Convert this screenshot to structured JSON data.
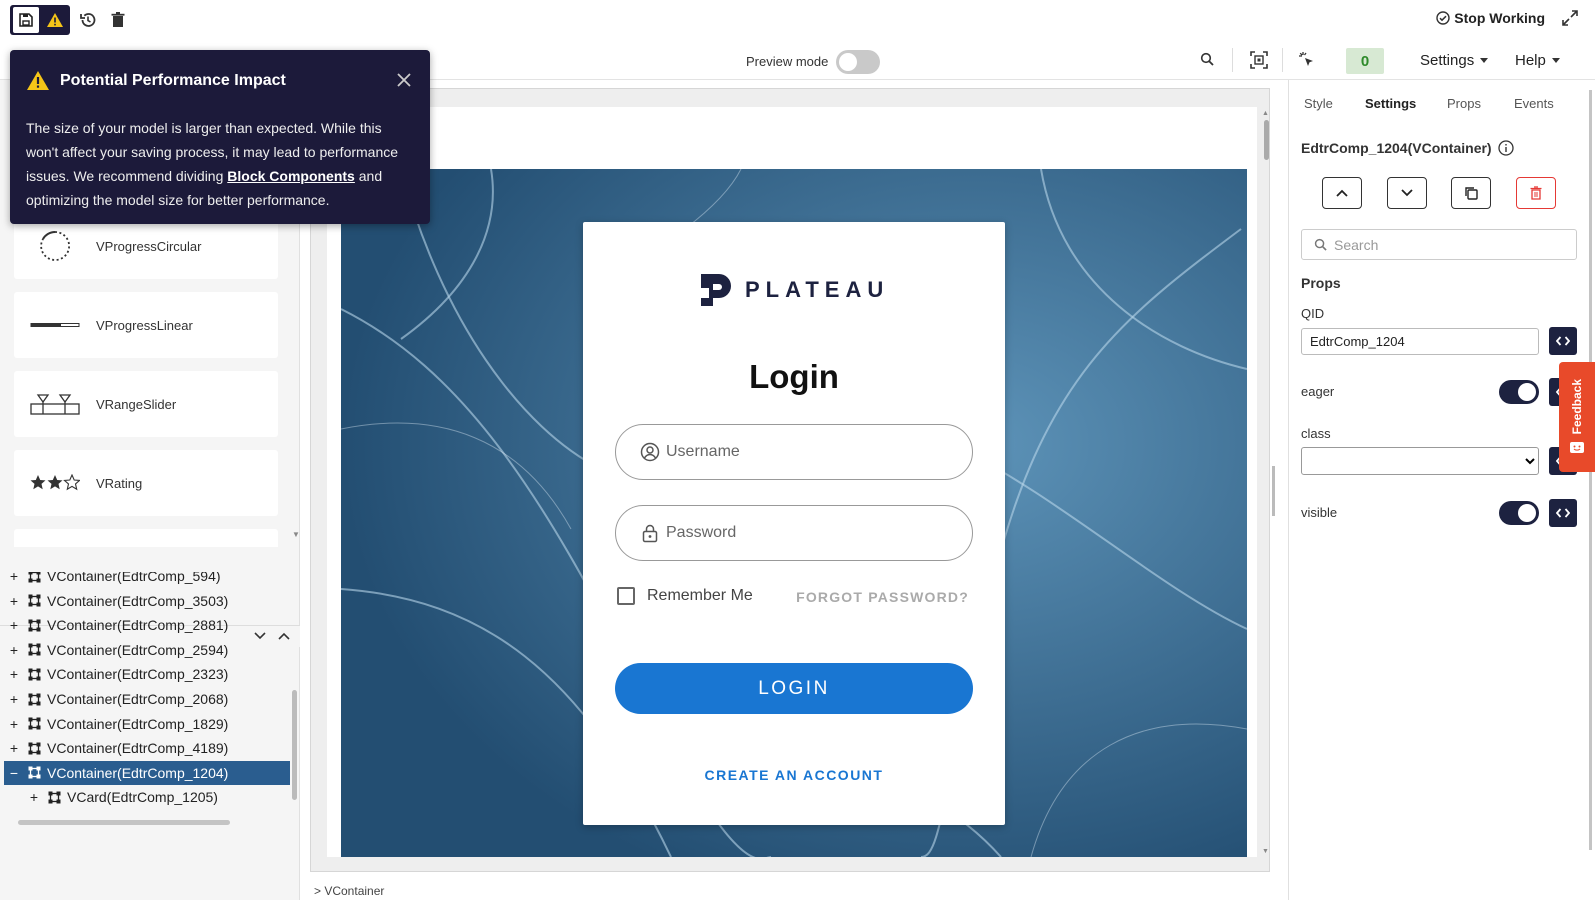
{
  "topbar": {
    "stop_working": "Stop Working"
  },
  "toolbar": {
    "preview_label": "Preview mode",
    "counter": "0",
    "settings_menu": "Settings",
    "help_menu": "Help"
  },
  "popup": {
    "title": "Potential Performance Impact",
    "body_before": "The size of your model is larger than expected. While this won't affect your saving process, it may lead to performance issues. We recommend dividing",
    "link": "Block Components",
    "body_after": "and optimizing the model size for better performance."
  },
  "components": [
    {
      "label": "VProgressCircular",
      "icon": "progress-circular-icon"
    },
    {
      "label": "VProgressLinear",
      "icon": "progress-linear-icon"
    },
    {
      "label": "VRangeSlider",
      "icon": "range-slider-icon"
    },
    {
      "label": "VRating",
      "icon": "rating-stars-icon"
    }
  ],
  "tree": [
    {
      "label": "VContainer(EdtrComp_594)",
      "expander": "+",
      "selected": false,
      "indent": 0
    },
    {
      "label": "VContainer(EdtrComp_3503)",
      "expander": "+",
      "selected": false,
      "indent": 0
    },
    {
      "label": "VContainer(EdtrComp_2881)",
      "expander": "+",
      "selected": false,
      "indent": 0
    },
    {
      "label": "VContainer(EdtrComp_2594)",
      "expander": "+",
      "selected": false,
      "indent": 0
    },
    {
      "label": "VContainer(EdtrComp_2323)",
      "expander": "+",
      "selected": false,
      "indent": 0
    },
    {
      "label": "VContainer(EdtrComp_2068)",
      "expander": "+",
      "selected": false,
      "indent": 0
    },
    {
      "label": "VContainer(EdtrComp_1829)",
      "expander": "+",
      "selected": false,
      "indent": 0
    },
    {
      "label": "VContainer(EdtrComp_4189)",
      "expander": "+",
      "selected": false,
      "indent": 0
    },
    {
      "label": "VContainer(EdtrComp_1204)",
      "expander": "−",
      "selected": true,
      "indent": 0
    },
    {
      "label": "VCard(EdtrComp_1205)",
      "expander": "+",
      "selected": false,
      "indent": 1
    }
  ],
  "breadcrumb": "> VContainer",
  "login": {
    "brand": "PLATEAU",
    "title": "Login",
    "username_placeholder": "Username",
    "password_placeholder": "Password",
    "remember_me": "Remember Me",
    "forgot_password": "FORGOT PASSWORD?",
    "login_button": "LOGIN",
    "create_account": "CREATE AN ACCOUNT",
    "primary_color": "#1976d2"
  },
  "right_panel": {
    "tabs": [
      {
        "label": "Style",
        "active": false
      },
      {
        "label": "Settings",
        "active": true
      },
      {
        "label": "Props",
        "active": false
      },
      {
        "label": "Events",
        "active": false
      }
    ],
    "component_title": "EdtrComp_1204(VContainer)",
    "search_placeholder": "Search",
    "props_heading": "Props",
    "qid_label": "QID",
    "qid_value": "EdtrComp_1204",
    "eager_label": "eager",
    "eager_on": true,
    "class_label": "class",
    "class_value": "",
    "visible_label": "visible",
    "visible_on": true,
    "feedback": "Feedback"
  },
  "colors": {
    "accent_dark": "#1d2240",
    "selected_row": "#2a5d8f",
    "popup_bg": "#1c1a3a",
    "warning": "#f5c518",
    "delete": "#e53935"
  }
}
